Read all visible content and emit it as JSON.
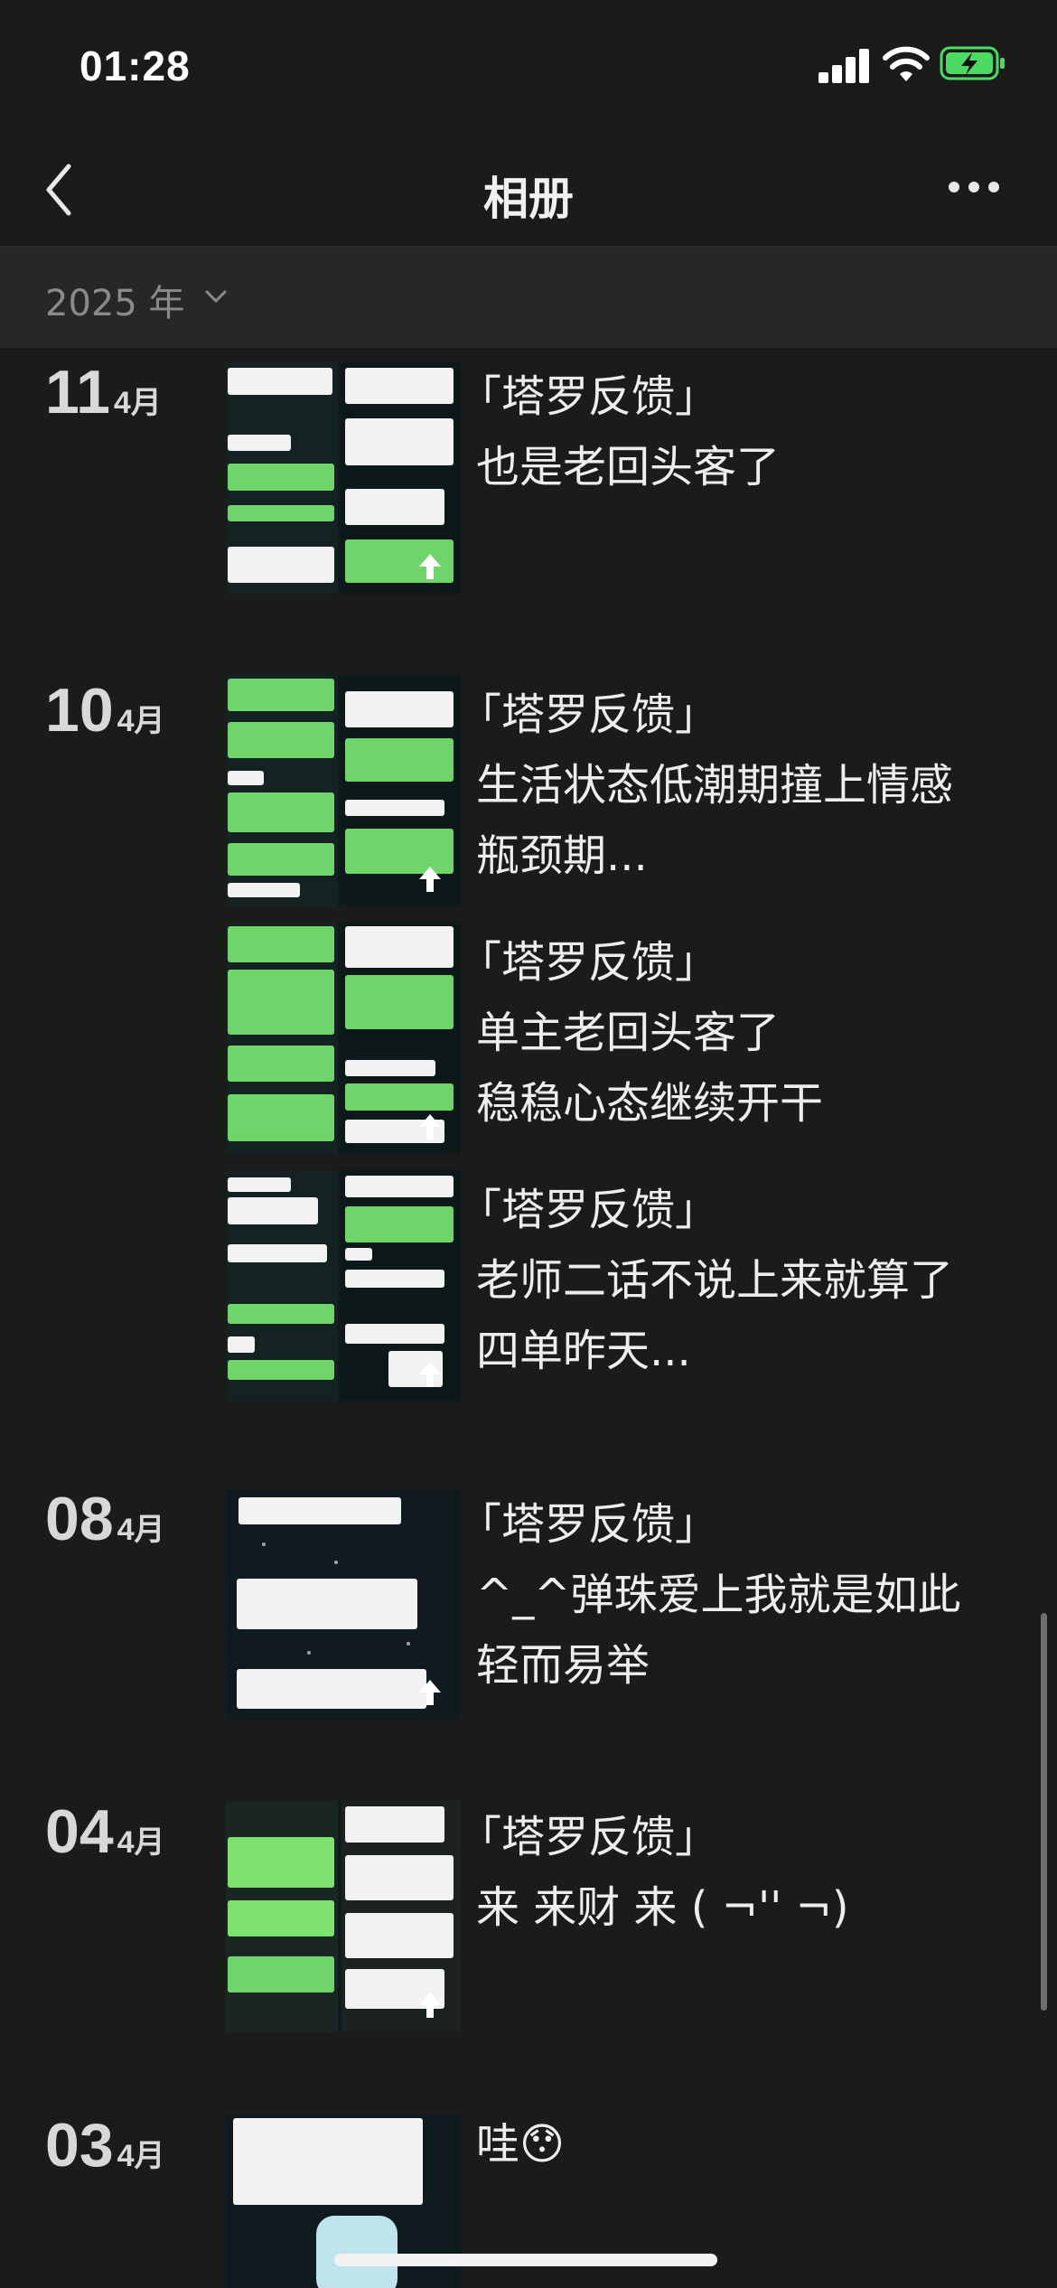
{
  "status_bar": {
    "time": "01:28"
  },
  "nav": {
    "title": "相册"
  },
  "year_filter": {
    "label": "2025 年"
  },
  "entries": [
    {
      "day": "11",
      "month": "4月",
      "title": "「塔罗反馈」",
      "body": "也是老回头客了"
    },
    {
      "day": "10",
      "month": "4月",
      "title": "「塔罗反馈」",
      "body": "生活状态低潮期撞上情感瓶颈期..."
    },
    {
      "day": "",
      "month": "",
      "title": "「塔罗反馈」",
      "body": "单主老回头客了\n稳稳心态继续开干"
    },
    {
      "day": "",
      "month": "",
      "title": "「塔罗反馈」",
      "body": "老师二话不说上来就算了四单昨天..."
    },
    {
      "day": "08",
      "month": "4月",
      "title": "「塔罗反馈」",
      "body": "^_^弹珠爱上我就是如此轻而易举"
    },
    {
      "day": "04",
      "month": "4月",
      "title": "「塔罗反馈」",
      "body": "来 来财 来 ( ¬'' ¬)"
    },
    {
      "day": "03",
      "month": "4月",
      "title": "",
      "body": "哇😯"
    }
  ]
}
